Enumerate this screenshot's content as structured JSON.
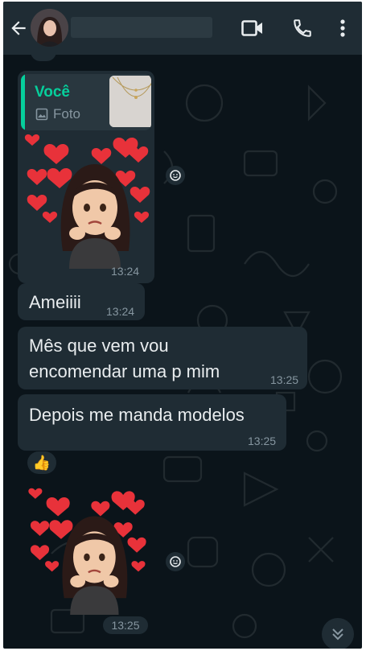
{
  "header": {
    "back_icon": "arrow-left-icon",
    "contact_name": "",
    "video_icon": "video-call-icon",
    "call_icon": "phone-icon",
    "menu_icon": "more-vert-icon"
  },
  "messages": {
    "sticker1": {
      "quote_author": "Você",
      "quote_type": "Foto",
      "time": "13:24"
    },
    "text1": {
      "text": "Ameiiii",
      "time": "13:24"
    },
    "text2": {
      "line1": "Mês que vem vou",
      "line2": "encomendar uma p mim",
      "time": "13:25"
    },
    "text3": {
      "text": "Depois me manda modelos",
      "time": "13:25"
    },
    "reaction": "👍",
    "sticker2": {
      "time": "13:25"
    }
  },
  "colors": {
    "background": "#0b141a",
    "header": "#1f2c34",
    "bubble": "#1f2c34",
    "quote_accent": "#06cf9c",
    "text": "#e9edef",
    "meta": "#8696a0"
  }
}
